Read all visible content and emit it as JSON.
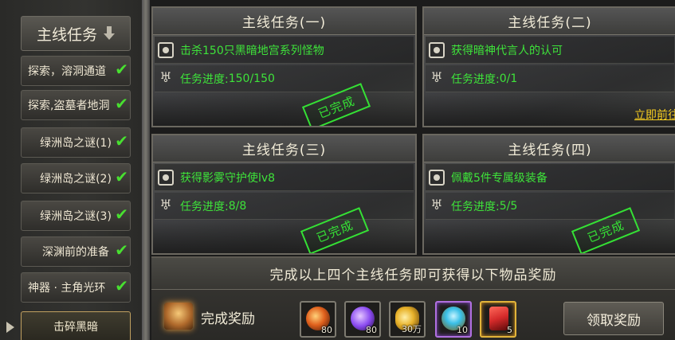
{
  "sidebar": {
    "header": "主线任务",
    "items": [
      {
        "label": "探索，溶洞通道",
        "done": true
      },
      {
        "label": "探索,盗墓者地洞",
        "done": true
      },
      {
        "label": "绿洲岛之谜(1)",
        "done": true
      },
      {
        "label": "绿洲岛之谜(2)",
        "done": true
      },
      {
        "label": "绿洲岛之谜(3)",
        "done": true
      },
      {
        "label": "深渊前的准备",
        "done": true
      },
      {
        "label": "神器 · 主角光环",
        "done": true
      }
    ],
    "active_item": "击碎黑暗"
  },
  "quests": [
    {
      "title": "主线任务(一)",
      "objective": "击杀150只黑暗地宫系列怪物",
      "progress_label": "任务进度: ",
      "progress_value": "150/150",
      "progress_current": "",
      "progress_total": "",
      "stamp": "已完成",
      "completed": true
    },
    {
      "title": "主线任务(二)",
      "objective": "获得暗神代言人的认可",
      "progress_label": "任务进度: ",
      "progress_value": "",
      "progress_current": "0",
      "progress_total": "/1",
      "stamp": "",
      "completed": false,
      "link": "立即前往"
    },
    {
      "title": "主线任务(三)",
      "objective": "获得影雾守护使lv8",
      "progress_label": "任务进度: ",
      "progress_value": "8/8",
      "progress_current": "",
      "progress_total": "",
      "stamp": "已完成",
      "completed": true
    },
    {
      "title": "主线任务(四)",
      "objective": "佩戴5件专属级装备",
      "progress_label": "任务进度: ",
      "progress_value": "5/5",
      "progress_current": "",
      "progress_total": "",
      "stamp": "已完成",
      "completed": true
    }
  ],
  "reward": {
    "title": "完成以上四个主线任务即可获得以下物品奖励",
    "label": "完成奖励",
    "items": [
      {
        "icon": "fire-orb-icon",
        "qty": "80",
        "color": "#e0601c"
      },
      {
        "icon": "purple-crystal-icon",
        "qty": "80",
        "color": "#8a4af0"
      },
      {
        "icon": "gold-coins-icon",
        "qty": "30万",
        "color": "#e8b22a"
      },
      {
        "icon": "fairy-gem-icon",
        "qty": "10",
        "color": "#3ac0e8"
      },
      {
        "icon": "red-card-icon",
        "qty": "5",
        "color": "#d42a2a"
      }
    ],
    "claim_button": "领取奖励"
  }
}
